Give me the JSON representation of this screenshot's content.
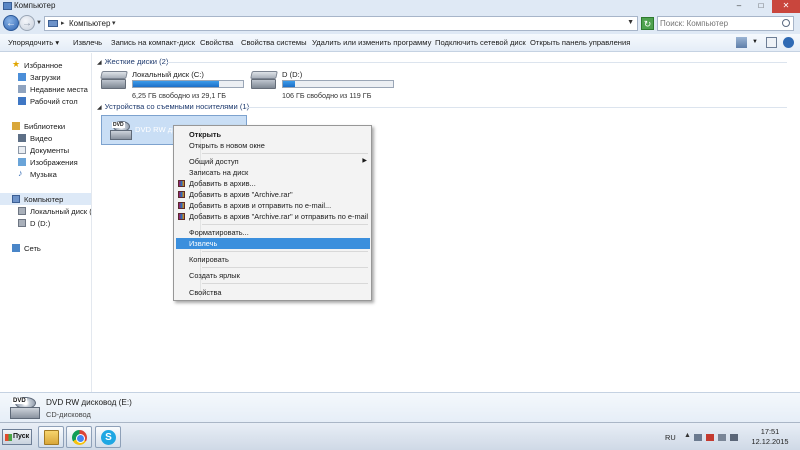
{
  "window": {
    "title": "Компьютер"
  },
  "address": {
    "path": "Компьютер",
    "search_placeholder": "Поиск: Компьютер"
  },
  "toolbar": {
    "items": [
      "Упорядочить",
      "Извлечь",
      "Запись на компакт-диск",
      "Свойства",
      "Свойства системы",
      "Удалить или изменить программу",
      "Подключить сетевой диск",
      "Открыть панель управления"
    ]
  },
  "sidebar": {
    "favorites": "Избранное",
    "downloads": "Загрузки",
    "recent": "Недавние места",
    "desktop": "Рабочий стол",
    "libraries": "Библиотеки",
    "video": "Видео",
    "documents": "Документы",
    "images": "Изображения",
    "music": "Музыка",
    "computer": "Компьютер",
    "local_disk": "Локальный диск (C",
    "d_drive": "D (D:)",
    "network": "Сеть"
  },
  "main": {
    "hdd_group": "Жесткие диски (2)",
    "removable_group": "Устройства со съемными носителями (1)",
    "drives": [
      {
        "name": "Локальный диск (C:)",
        "free_text": "6,25 ГБ свободно из 29,1 ГБ",
        "used_fraction": 0.785
      },
      {
        "name": "D (D:)",
        "free_text": "106 ГБ свободно из 119 ГБ",
        "used_fraction": 0.11
      }
    ],
    "dvd_label": "DVD RW диско"
  },
  "context_menu": {
    "open": "Открыть",
    "open_new_window": "Открыть в новом окне",
    "share": "Общий доступ",
    "burn": "Записать на диск",
    "add_archive": "Добавить в архив...",
    "add_archive_rar": "Добавить в архив \"Archive.rar\"",
    "add_email": "Добавить в архив и отправить по e-mail...",
    "add_rar_email": "Добавить в архив \"Archive.rar\" и отправить по e-mail",
    "format": "Форматировать...",
    "eject": "Извлечь",
    "copy": "Копировать",
    "shortcut": "Создать ярлык",
    "properties": "Свойства"
  },
  "details": {
    "name": "DVD RW дисковод (E:)",
    "type": "CD-дисковод"
  },
  "taskbar": {
    "start": "Пуск",
    "lang": "RU",
    "time": "17:51",
    "date": "12.12.2015"
  }
}
